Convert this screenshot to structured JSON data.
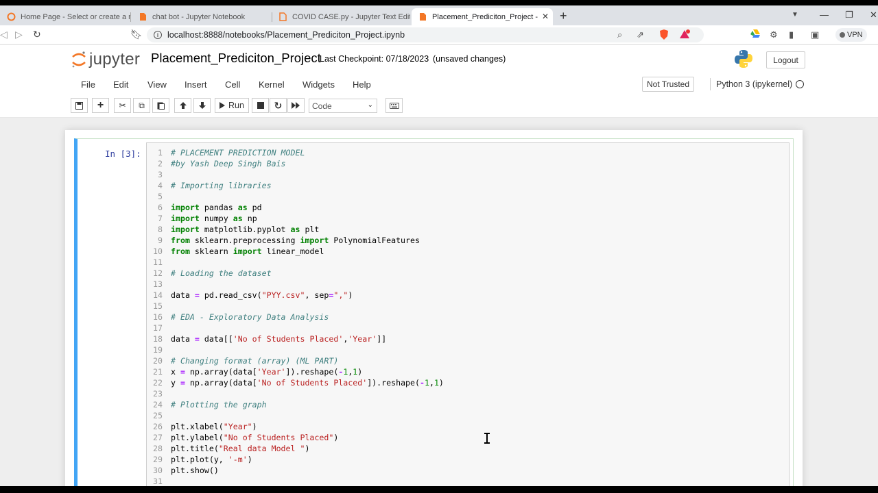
{
  "browser": {
    "tabs": [
      {
        "label": "Home Page - Select or create a notebook",
        "active": false
      },
      {
        "label": "chat bot - Jupyter Notebook",
        "active": false
      },
      {
        "label": "COVID CASE.py - Jupyter Text Editor",
        "active": false
      },
      {
        "label": "Placement_Prediciton_Project - Jupyter Notebook",
        "active": true
      }
    ],
    "url": "localhost:8888/notebooks/Placement_Prediciton_Project.ipynb",
    "vpn_label": "VPN"
  },
  "jupyter": {
    "logo_text": "jupyter",
    "notebook_name": "Placement_Prediciton_Project",
    "checkpoint": "Last Checkpoint: 07/18/2023",
    "status": "(unsaved changes)",
    "logout_label": "Logout",
    "menu": [
      "File",
      "Edit",
      "View",
      "Insert",
      "Cell",
      "Kernel",
      "Widgets",
      "Help"
    ],
    "trust_label": "Not Trusted",
    "kernel_name": "Python 3 (ipykernel)",
    "run_label": "Run",
    "cell_type": "Code"
  },
  "cell": {
    "prompt": "In [3]:",
    "lines": [
      [
        [
          "c-com",
          "# PLACEMENT PREDICTION MODEL"
        ]
      ],
      [
        [
          "c-com",
          "#by Yash Deep Singh Bais"
        ]
      ],
      [],
      [
        [
          "c-com",
          "# Importing libraries"
        ]
      ],
      [],
      [
        [
          "c-kw",
          "import"
        ],
        [
          "",
          " pandas "
        ],
        [
          "c-kw",
          "as"
        ],
        [
          "",
          " pd"
        ]
      ],
      [
        [
          "c-kw",
          "import"
        ],
        [
          "",
          " numpy "
        ],
        [
          "c-kw",
          "as"
        ],
        [
          "",
          " np"
        ]
      ],
      [
        [
          "c-kw",
          "import"
        ],
        [
          "",
          " matplotlib.pyplot "
        ],
        [
          "c-kw",
          "as"
        ],
        [
          "",
          " plt"
        ]
      ],
      [
        [
          "c-kw",
          "from"
        ],
        [
          "",
          " sklearn.preprocessing "
        ],
        [
          "c-kw",
          "import"
        ],
        [
          "",
          " PolynomialFeatures"
        ]
      ],
      [
        [
          "c-kw",
          "from"
        ],
        [
          "",
          " sklearn "
        ],
        [
          "c-kw",
          "import"
        ],
        [
          "",
          " linear_model"
        ]
      ],
      [],
      [
        [
          "c-com",
          "# Loading the dataset"
        ]
      ],
      [],
      [
        [
          "",
          "data "
        ],
        [
          "c-op",
          "="
        ],
        [
          "",
          " pd.read_csv("
        ],
        [
          "c-str",
          "\"PYY.csv\""
        ],
        [
          "",
          ", sep"
        ],
        [
          "c-op",
          "="
        ],
        [
          "c-str",
          "\",\""
        ],
        [
          "",
          ")"
        ]
      ],
      [],
      [
        [
          "c-com",
          "# EDA - Exploratory Data Analysis"
        ]
      ],
      [],
      [
        [
          "",
          "data "
        ],
        [
          "c-op",
          "="
        ],
        [
          "",
          " data[["
        ],
        [
          "c-str",
          "'No of Students Placed'"
        ],
        [
          "",
          ","
        ],
        [
          "c-str",
          "'Year'"
        ],
        [
          "",
          "]]"
        ]
      ],
      [],
      [
        [
          "c-com",
          "# Changing format (array) (ML PART)"
        ]
      ],
      [
        [
          "",
          "x "
        ],
        [
          "c-op",
          "="
        ],
        [
          "",
          " np.array(data["
        ],
        [
          "c-str",
          "'Year'"
        ],
        [
          "",
          "]).reshape("
        ],
        [
          "c-op",
          "-"
        ],
        [
          "c-num",
          "1"
        ],
        [
          "",
          ","
        ],
        [
          "c-num",
          "1"
        ],
        [
          "",
          ")"
        ]
      ],
      [
        [
          "",
          "y "
        ],
        [
          "c-op",
          "="
        ],
        [
          "",
          " np.array(data["
        ],
        [
          "c-str",
          "'No of Students Placed'"
        ],
        [
          "",
          "]).reshape("
        ],
        [
          "c-op",
          "-"
        ],
        [
          "c-num",
          "1"
        ],
        [
          "",
          ","
        ],
        [
          "c-num",
          "1"
        ],
        [
          "",
          ")"
        ]
      ],
      [],
      [
        [
          "c-com",
          "# Plotting the graph"
        ]
      ],
      [],
      [
        [
          "",
          "plt.xlabel("
        ],
        [
          "c-str",
          "\"Year\""
        ],
        [
          "",
          ")"
        ]
      ],
      [
        [
          "",
          "plt.ylabel("
        ],
        [
          "c-str",
          "\"No of Students Placed\""
        ],
        [
          "",
          ")"
        ]
      ],
      [
        [
          "",
          "plt.title("
        ],
        [
          "c-str",
          "\"Real data Model \""
        ],
        [
          "",
          ")"
        ]
      ],
      [
        [
          "",
          "plt.plot(y, "
        ],
        [
          "c-str",
          "'-m'"
        ],
        [
          "",
          ")"
        ]
      ],
      [
        [
          "",
          "plt.show()"
        ]
      ],
      []
    ]
  },
  "colors": {
    "accent_blue": "#42a5f5",
    "jupyter_orange": "#f37726",
    "comment": "#408080",
    "keyword": "#008000",
    "string": "#ba2121"
  }
}
